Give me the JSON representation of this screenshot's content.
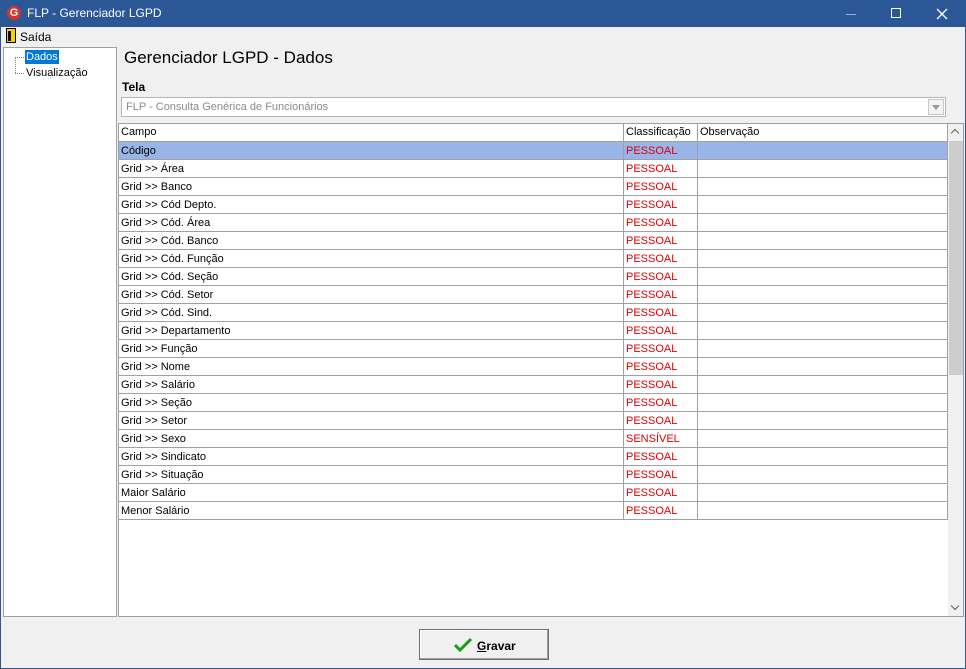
{
  "window": {
    "title": "FLP - Gerenciador LGPD",
    "icon": "app-logo-icon"
  },
  "menu": {
    "exit_label": "Saída",
    "exit_icon": "exit-door-icon"
  },
  "tree": {
    "items": [
      {
        "label": "Dados",
        "selected": true
      },
      {
        "label": "Visualização",
        "selected": false
      }
    ]
  },
  "main": {
    "title": "Gerenciador LGPD - Dados",
    "tela_label": "Tela",
    "tela_value": "FLP - Consulta Genérica de Funcionários"
  },
  "grid": {
    "columns": [
      "Campo",
      "Classificação",
      "Observação"
    ],
    "rows": [
      {
        "campo": "Código",
        "classificacao": "PESSOAL",
        "observacao": ""
      },
      {
        "campo": "Grid >> Área",
        "classificacao": "PESSOAL",
        "observacao": ""
      },
      {
        "campo": "Grid >> Banco",
        "classificacao": "PESSOAL",
        "observacao": ""
      },
      {
        "campo": "Grid >> Cód Depto.",
        "classificacao": "PESSOAL",
        "observacao": ""
      },
      {
        "campo": "Grid >> Cód. Área",
        "classificacao": "PESSOAL",
        "observacao": ""
      },
      {
        "campo": "Grid >> Cód. Banco",
        "classificacao": "PESSOAL",
        "observacao": ""
      },
      {
        "campo": "Grid >> Cód. Função",
        "classificacao": "PESSOAL",
        "observacao": ""
      },
      {
        "campo": "Grid >> Cód. Seção",
        "classificacao": "PESSOAL",
        "observacao": ""
      },
      {
        "campo": "Grid >> Cód. Setor",
        "classificacao": "PESSOAL",
        "observacao": ""
      },
      {
        "campo": "Grid >> Cód. Sind.",
        "classificacao": "PESSOAL",
        "observacao": ""
      },
      {
        "campo": "Grid >> Departamento",
        "classificacao": "PESSOAL",
        "observacao": ""
      },
      {
        "campo": "Grid >> Função",
        "classificacao": "PESSOAL",
        "observacao": ""
      },
      {
        "campo": "Grid >> Nome",
        "classificacao": "PESSOAL",
        "observacao": ""
      },
      {
        "campo": "Grid >> Salário",
        "classificacao": "PESSOAL",
        "observacao": ""
      },
      {
        "campo": "Grid >> Seção",
        "classificacao": "PESSOAL",
        "observacao": ""
      },
      {
        "campo": "Grid >> Setor",
        "classificacao": "PESSOAL",
        "observacao": ""
      },
      {
        "campo": "Grid >> Sexo",
        "classificacao": "SENSÍVEL",
        "observacao": ""
      },
      {
        "campo": "Grid >> Sindicato",
        "classificacao": "PESSOAL",
        "observacao": ""
      },
      {
        "campo": "Grid >> Situação",
        "classificacao": "PESSOAL",
        "observacao": ""
      },
      {
        "campo": "Maior Salário",
        "classificacao": "PESSOAL",
        "observacao": ""
      },
      {
        "campo": "Menor Salário",
        "classificacao": "PESSOAL",
        "observacao": ""
      }
    ],
    "selected_row": 0
  },
  "footer": {
    "save_label": "Gravar",
    "save_icon": "checkmark-icon"
  },
  "colors": {
    "titlebar": "#2b5797",
    "selection": "#99b4e8",
    "tree_selection": "#0078d7",
    "classification_text": "#e00000",
    "check_green": "#1a9a1a"
  }
}
